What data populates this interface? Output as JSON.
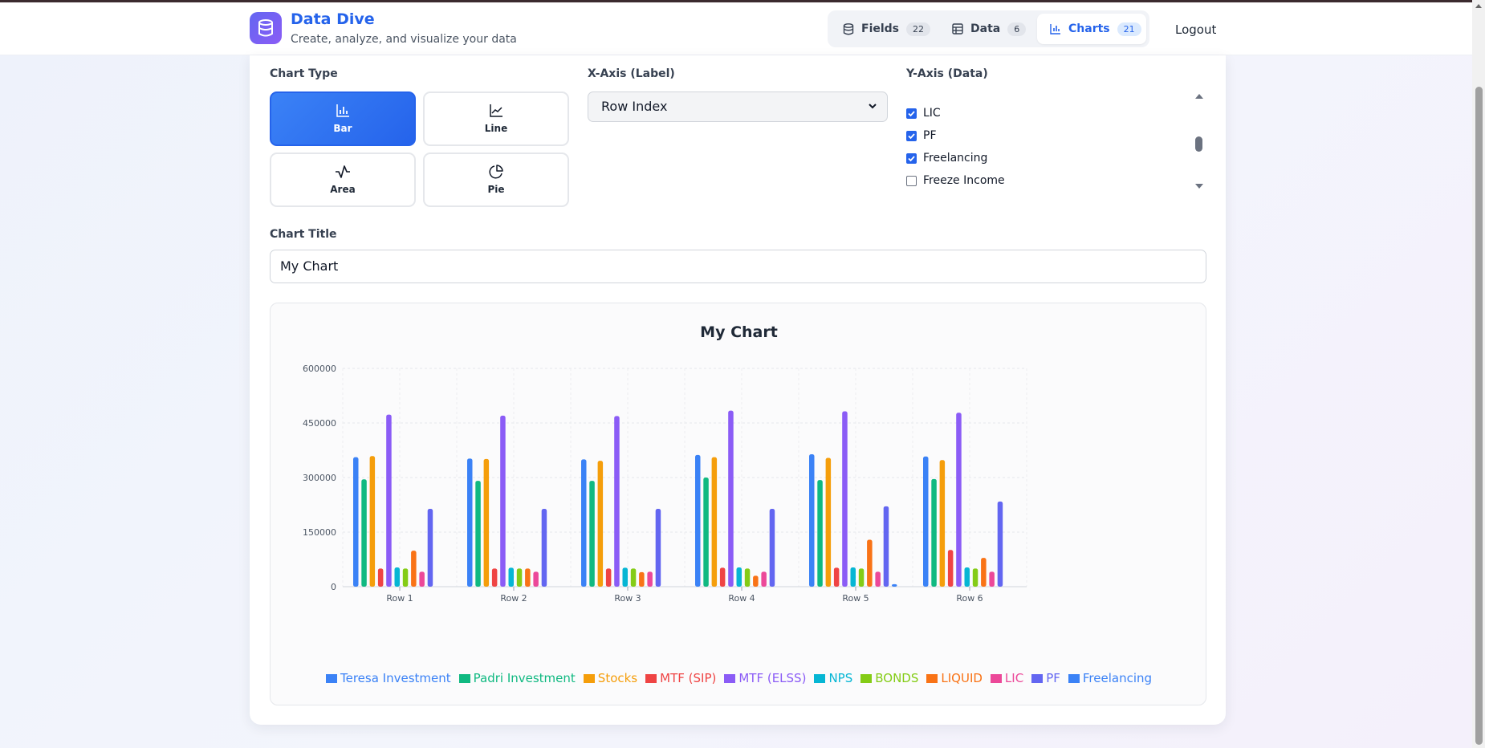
{
  "app": {
    "title": "Data Dive",
    "subtitle": "Create, analyze, and visualize your data"
  },
  "nav": {
    "tabs": [
      {
        "label": "Fields",
        "count": "22",
        "icon": "database-icon"
      },
      {
        "label": "Data",
        "count": "6",
        "icon": "table-icon"
      },
      {
        "label": "Charts",
        "count": "21",
        "icon": "bar-chart-icon",
        "active": true
      }
    ],
    "logout": "Logout"
  },
  "builder": {
    "chart_type_label": "Chart Type",
    "types": [
      {
        "label": "Bar",
        "icon": "bar-chart-icon",
        "active": true
      },
      {
        "label": "Line",
        "icon": "line-chart-icon"
      },
      {
        "label": "Area",
        "icon": "activity-icon"
      },
      {
        "label": "Pie",
        "icon": "pie-chart-icon"
      }
    ],
    "x_axis_label": "X-Axis (Label)",
    "x_axis_value": "Row Index",
    "y_axis_label": "Y-Axis (Data)",
    "y_fields": [
      {
        "label": "LIC",
        "checked": true
      },
      {
        "label": "PF",
        "checked": true
      },
      {
        "label": "Freelancing",
        "checked": true
      },
      {
        "label": "Freeze Income",
        "checked": false
      }
    ],
    "chart_title_label": "Chart Title",
    "chart_title_value": "My Chart"
  },
  "chart_data": {
    "type": "bar",
    "title": "My Chart",
    "categories": [
      "Row 1",
      "Row 2",
      "Row 3",
      "Row 4",
      "Row 5",
      "Row 6"
    ],
    "ylim": [
      0,
      600000
    ],
    "yticks": [
      "0",
      "150000",
      "300000",
      "450000",
      "600000"
    ],
    "grid": true,
    "legend_position": "bottom",
    "series": [
      {
        "name": "Teresa Investment",
        "color": "#3b82f6",
        "values": [
          356000,
          352000,
          350000,
          362000,
          364000,
          358000
        ]
      },
      {
        "name": "Padri Investment",
        "color": "#10b981",
        "values": [
          295000,
          291000,
          291000,
          300000,
          293000,
          296000
        ]
      },
      {
        "name": "Stocks",
        "color": "#f59e0b",
        "values": [
          359000,
          351000,
          346000,
          356000,
          354000,
          348000
        ]
      },
      {
        "name": "MTF (SIP)",
        "color": "#ef4444",
        "values": [
          50000,
          50000,
          50000,
          52000,
          52000,
          101000
        ]
      },
      {
        "name": "MTF (ELSS)",
        "color": "#8b5cf6",
        "values": [
          473000,
          470000,
          469000,
          484000,
          482000,
          478000
        ]
      },
      {
        "name": "NPS",
        "color": "#06b6d4",
        "values": [
          53000,
          52000,
          52000,
          53000,
          53000,
          53000
        ]
      },
      {
        "name": "BONDS",
        "color": "#84cc16",
        "values": [
          50000,
          50000,
          50000,
          50000,
          50000,
          50000
        ]
      },
      {
        "name": "LIQUID",
        "color": "#f97316",
        "values": [
          99000,
          50000,
          40000,
          30000,
          129000,
          79000
        ]
      },
      {
        "name": "LIC",
        "color": "#ec4899",
        "values": [
          41000,
          41000,
          41000,
          41000,
          41000,
          41000
        ]
      },
      {
        "name": "PF",
        "color": "#6366f1",
        "values": [
          214000,
          214000,
          214000,
          214000,
          221000,
          234000
        ]
      },
      {
        "name": "Freelancing",
        "color": "#3b82f6",
        "values": [
          0,
          0,
          0,
          0,
          7000,
          0
        ]
      }
    ]
  }
}
